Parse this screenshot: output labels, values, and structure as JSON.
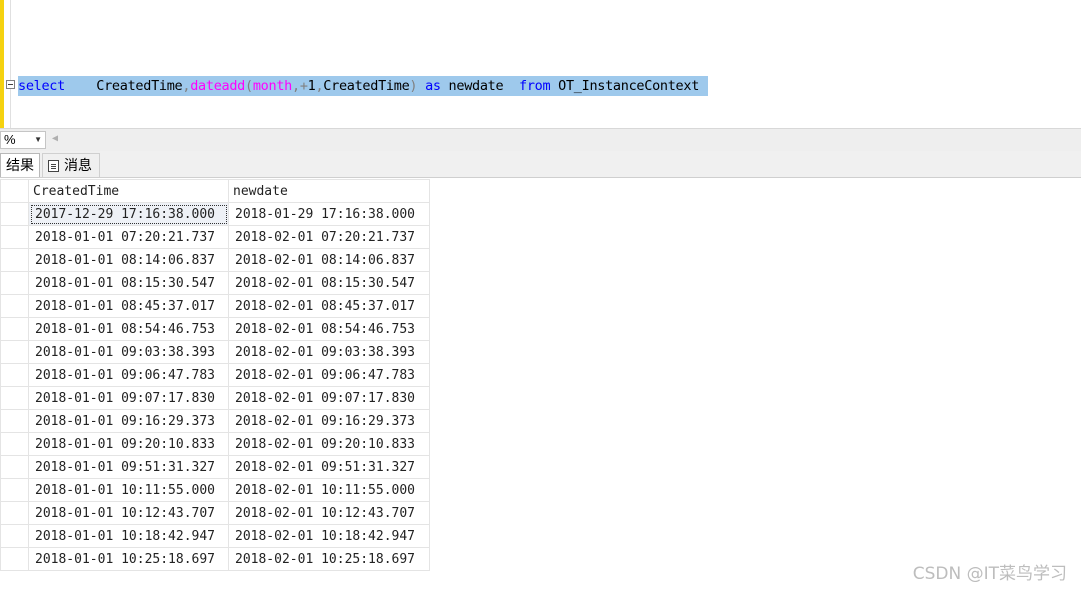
{
  "editor": {
    "tokens": [
      {
        "t": "select",
        "c": "kw"
      },
      {
        "t": "    ",
        "c": "id"
      },
      {
        "t": "CreatedTime",
        "c": "id"
      },
      {
        "t": ",",
        "c": "gr"
      },
      {
        "t": "dateadd",
        "c": "fn"
      },
      {
        "t": "(",
        "c": "gr"
      },
      {
        "t": "month",
        "c": "fn"
      },
      {
        "t": ",",
        "c": "gr"
      },
      {
        "t": "+",
        "c": "gr"
      },
      {
        "t": "1",
        "c": "id"
      },
      {
        "t": ",",
        "c": "gr"
      },
      {
        "t": "CreatedTime",
        "c": "id"
      },
      {
        "t": ") ",
        "c": "gr"
      },
      {
        "t": "as",
        "c": "kw"
      },
      {
        "t": " newdate  ",
        "c": "id"
      },
      {
        "t": "from",
        "c": "kw"
      },
      {
        "t": " OT_InstanceContext",
        "c": "id"
      }
    ],
    "highlight_color": "#9ec9ec"
  },
  "zoom": {
    "value": "%"
  },
  "tabs": {
    "results": "结果",
    "messages": "消息"
  },
  "grid": {
    "columns": [
      "CreatedTime",
      "newdate"
    ],
    "rows": [
      [
        "2017-12-29 17:16:38.000",
        "2018-01-29 17:16:38.000"
      ],
      [
        "2018-01-01 07:20:21.737",
        "2018-02-01 07:20:21.737"
      ],
      [
        "2018-01-01 08:14:06.837",
        "2018-02-01 08:14:06.837"
      ],
      [
        "2018-01-01 08:15:30.547",
        "2018-02-01 08:15:30.547"
      ],
      [
        "2018-01-01 08:45:37.017",
        "2018-02-01 08:45:37.017"
      ],
      [
        "2018-01-01 08:54:46.753",
        "2018-02-01 08:54:46.753"
      ],
      [
        "2018-01-01 09:03:38.393",
        "2018-02-01 09:03:38.393"
      ],
      [
        "2018-01-01 09:06:47.783",
        "2018-02-01 09:06:47.783"
      ],
      [
        "2018-01-01 09:07:17.830",
        "2018-02-01 09:07:17.830"
      ],
      [
        "2018-01-01 09:16:29.373",
        "2018-02-01 09:16:29.373"
      ],
      [
        "2018-01-01 09:20:10.833",
        "2018-02-01 09:20:10.833"
      ],
      [
        "2018-01-01 09:51:31.327",
        "2018-02-01 09:51:31.327"
      ],
      [
        "2018-01-01 10:11:55.000",
        "2018-02-01 10:11:55.000"
      ],
      [
        "2018-01-01 10:12:43.707",
        "2018-02-01 10:12:43.707"
      ],
      [
        "2018-01-01 10:18:42.947",
        "2018-02-01 10:18:42.947"
      ],
      [
        "2018-01-01 10:25:18.697",
        "2018-02-01 10:25:18.697"
      ]
    ]
  },
  "watermark": "CSDN @IT菜鸟学习"
}
